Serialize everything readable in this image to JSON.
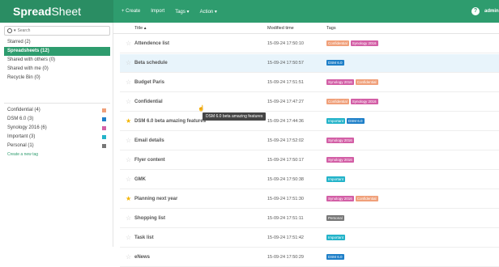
{
  "app": {
    "brand_bold": "Spread",
    "brand_light": "Sheet",
    "user": "admin"
  },
  "menu": [
    {
      "label": "+ Create"
    },
    {
      "label": "Import"
    },
    {
      "label": "Tags ▾"
    },
    {
      "label": "Action ▾"
    }
  ],
  "search": {
    "placeholder": "Search"
  },
  "nav": [
    {
      "label": "Starred (2)"
    },
    {
      "label": "Spreadsheets (12)"
    },
    {
      "label": "Shared with others (0)"
    },
    {
      "label": "Shared with me (0)"
    },
    {
      "label": "Recycle Bin (0)"
    }
  ],
  "tag_nav": [
    {
      "label": "Confidential (4)",
      "color": "#f0a07a"
    },
    {
      "label": "DSM 6.0 (3)",
      "color": "#1e7fc8"
    },
    {
      "label": "Synology 2016 (6)",
      "color": "#d35fa6"
    },
    {
      "label": "Important (3)",
      "color": "#23b3c9"
    },
    {
      "label": "Personal (1)",
      "color": "#777777"
    }
  ],
  "create_tag_label": "Create a new tag",
  "columns": {
    "title": "Title ▴",
    "modified": "Modified time",
    "tags": "Tags"
  },
  "tag_colors": {
    "Confidential": "#f0a07a",
    "Synology 2016": "#d35fa6",
    "DSM 6.0": "#1e7fc8",
    "Important": "#23b3c9",
    "Personal": "#777777"
  },
  "rows": [
    {
      "title": "Attendence list",
      "modified": "15-09-24 17:50:10",
      "starred": false,
      "selected": false,
      "tags": [
        "Confidential",
        "Synology 2016"
      ]
    },
    {
      "title": "Beta schedule",
      "modified": "15-09-24 17:50:57",
      "starred": false,
      "selected": true,
      "tags": [
        "DSM 6.0"
      ]
    },
    {
      "title": "Budget Paris",
      "modified": "15-09-24 17:51:51",
      "starred": false,
      "selected": false,
      "tags": [
        "Synology 2016",
        "Confidential"
      ]
    },
    {
      "title": "Confidential",
      "modified": "15-09-24 17:47:27",
      "starred": false,
      "selected": false,
      "tags": [
        "Confidential",
        "Synology 2016"
      ]
    },
    {
      "title": "DSM 6.0 beta amazing features",
      "modified": "15-09-24 17:44:36",
      "starred": true,
      "selected": false,
      "tags": [
        "Important",
        "DSM 6.0"
      ]
    },
    {
      "title": "Email details",
      "modified": "15-09-24 17:52:02",
      "starred": false,
      "selected": false,
      "tags": [
        "Synology 2016"
      ]
    },
    {
      "title": "Flyer content",
      "modified": "15-09-24 17:50:17",
      "starred": false,
      "selected": false,
      "tags": [
        "Synology 2016"
      ]
    },
    {
      "title": "GMK",
      "modified": "15-09-24 17:50:38",
      "starred": false,
      "selected": false,
      "tags": [
        "Important"
      ]
    },
    {
      "title": "Planning next year",
      "modified": "15-09-24 17:51:30",
      "starred": true,
      "selected": false,
      "tags": [
        "Synology 2016",
        "Confidential"
      ]
    },
    {
      "title": "Shopping list",
      "modified": "15-09-24 17:51:11",
      "starred": false,
      "selected": false,
      "tags": [
        "Personal"
      ]
    },
    {
      "title": "Task list",
      "modified": "15-09-24 17:51:42",
      "starred": false,
      "selected": false,
      "tags": [
        "Important"
      ]
    },
    {
      "title": "eNews",
      "modified": "15-09-24 17:50:29",
      "starred": false,
      "selected": false,
      "tags": [
        "DSM 6.0"
      ]
    }
  ],
  "tooltip": "DSM 6.0 beta amazing features"
}
